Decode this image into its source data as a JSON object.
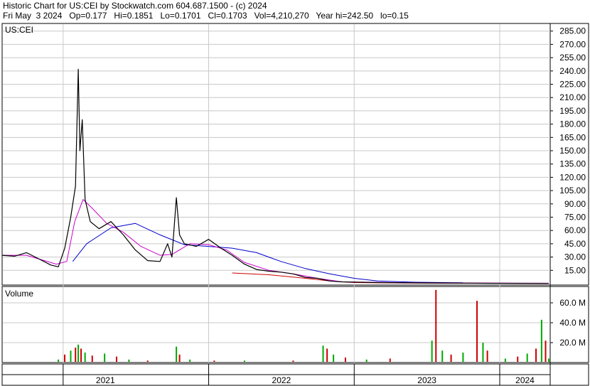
{
  "header": {
    "line1": "Historic Chart for US:CEI by Stockwatch.com 604.687.1500 - (c) 2024",
    "line2": "Fri May  3 2024   Op=0.177   Hi=0.1851   Lo=0.1701   Cl=0.1703   Vol=4,210,270   Year hi=242.50   lo=0.15"
  },
  "chart_data": {
    "type": "line",
    "symbol_label": "US:CEI",
    "volume_label": "Volume",
    "price_axis": {
      "min": 0,
      "max": 292,
      "ticks": [
        "285.00",
        "270.00",
        "255.00",
        "240.00",
        "225.00",
        "210.00",
        "195.00",
        "180.00",
        "165.00",
        "150.00",
        "135.00",
        "120.00",
        "105.00",
        "90.00",
        "75.00",
        "60.00",
        "45.00",
        "30.00",
        "15.00"
      ]
    },
    "volume_axis": {
      "min": 0,
      "max": 75,
      "unit": "M",
      "ticks": [
        "60.0 M",
        "40.0 M",
        "20.0 M"
      ]
    },
    "years": [
      "2021",
      "2022",
      "2023",
      "2024"
    ],
    "x_range": [
      "2020-08-01",
      "2024-05-03"
    ],
    "price_series": [
      {
        "t": "2020-08-01",
        "v": 32
      },
      {
        "t": "2020-09-01",
        "v": 31
      },
      {
        "t": "2020-10-01",
        "v": 35
      },
      {
        "t": "2020-11-01",
        "v": 28
      },
      {
        "t": "2020-12-01",
        "v": 21
      },
      {
        "t": "2020-12-20",
        "v": 19
      },
      {
        "t": "2021-01-05",
        "v": 40
      },
      {
        "t": "2021-01-20",
        "v": 75
      },
      {
        "t": "2021-02-01",
        "v": 110
      },
      {
        "t": "2021-02-08",
        "v": 242
      },
      {
        "t": "2021-02-12",
        "v": 150
      },
      {
        "t": "2021-02-18",
        "v": 185
      },
      {
        "t": "2021-02-25",
        "v": 95
      },
      {
        "t": "2021-03-10",
        "v": 70
      },
      {
        "t": "2021-04-01",
        "v": 62
      },
      {
        "t": "2021-05-01",
        "v": 70
      },
      {
        "t": "2021-06-01",
        "v": 55
      },
      {
        "t": "2021-07-01",
        "v": 38
      },
      {
        "t": "2021-08-01",
        "v": 26
      },
      {
        "t": "2021-09-01",
        "v": 25
      },
      {
        "t": "2021-09-20",
        "v": 45
      },
      {
        "t": "2021-10-01",
        "v": 30
      },
      {
        "t": "2021-10-12",
        "v": 97
      },
      {
        "t": "2021-10-20",
        "v": 55
      },
      {
        "t": "2021-11-01",
        "v": 45
      },
      {
        "t": "2021-12-01",
        "v": 42
      },
      {
        "t": "2022-01-01",
        "v": 50
      },
      {
        "t": "2022-02-01",
        "v": 40
      },
      {
        "t": "2022-03-01",
        "v": 32
      },
      {
        "t": "2022-04-01",
        "v": 22
      },
      {
        "t": "2022-05-01",
        "v": 16
      },
      {
        "t": "2022-06-01",
        "v": 14
      },
      {
        "t": "2022-07-01",
        "v": 13
      },
      {
        "t": "2022-08-01",
        "v": 11
      },
      {
        "t": "2022-09-01",
        "v": 7
      },
      {
        "t": "2022-10-01",
        "v": 6
      },
      {
        "t": "2022-11-01",
        "v": 3
      },
      {
        "t": "2022-12-01",
        "v": 2
      },
      {
        "t": "2023-03-01",
        "v": 1.2
      },
      {
        "t": "2023-07-01",
        "v": 0.8
      },
      {
        "t": "2023-12-01",
        "v": 0.4
      },
      {
        "t": "2024-05-03",
        "v": 0.17
      }
    ],
    "ma_short": [
      {
        "t": "2020-08-01",
        "v": 32
      },
      {
        "t": "2020-10-01",
        "v": 32
      },
      {
        "t": "2020-12-15",
        "v": 22
      },
      {
        "t": "2021-01-10",
        "v": 25
      },
      {
        "t": "2021-01-30",
        "v": 70
      },
      {
        "t": "2021-02-20",
        "v": 95
      },
      {
        "t": "2021-03-15",
        "v": 85
      },
      {
        "t": "2021-04-20",
        "v": 68
      },
      {
        "t": "2021-06-01",
        "v": 58
      },
      {
        "t": "2021-07-15",
        "v": 42
      },
      {
        "t": "2021-09-01",
        "v": 32
      },
      {
        "t": "2021-10-01",
        "v": 33
      },
      {
        "t": "2021-11-15",
        "v": 45
      },
      {
        "t": "2022-01-01",
        "v": 44
      },
      {
        "t": "2022-02-15",
        "v": 38
      },
      {
        "t": "2022-04-01",
        "v": 24
      },
      {
        "t": "2022-06-01",
        "v": 15
      },
      {
        "t": "2022-08-01",
        "v": 11
      },
      {
        "t": "2022-10-01",
        "v": 6
      },
      {
        "t": "2022-12-01",
        "v": 2
      },
      {
        "t": "2023-06-01",
        "v": 1
      },
      {
        "t": "2024-05-03",
        "v": 0.5
      }
    ],
    "ma_long": [
      {
        "t": "2021-01-25",
        "v": 25
      },
      {
        "t": "2021-03-01",
        "v": 45
      },
      {
        "t": "2021-05-01",
        "v": 63
      },
      {
        "t": "2021-07-01",
        "v": 68
      },
      {
        "t": "2021-09-01",
        "v": 55
      },
      {
        "t": "2021-11-01",
        "v": 44
      },
      {
        "t": "2022-01-01",
        "v": 42
      },
      {
        "t": "2022-03-01",
        "v": 40
      },
      {
        "t": "2022-05-01",
        "v": 35
      },
      {
        "t": "2022-07-01",
        "v": 25
      },
      {
        "t": "2022-09-01",
        "v": 17
      },
      {
        "t": "2022-11-01",
        "v": 11
      },
      {
        "t": "2023-01-01",
        "v": 6
      },
      {
        "t": "2023-03-01",
        "v": 3
      },
      {
        "t": "2023-06-01",
        "v": 1.6
      },
      {
        "t": "2023-10-01",
        "v": 1
      }
    ],
    "ma_ultra": [
      {
        "t": "2022-03-01",
        "v": 12
      },
      {
        "t": "2022-06-01",
        "v": 10
      },
      {
        "t": "2022-09-01",
        "v": 6
      },
      {
        "t": "2022-11-01",
        "v": 3
      },
      {
        "t": "2023-01-01",
        "v": 1.2
      },
      {
        "t": "2023-06-01",
        "v": 0.6
      },
      {
        "t": "2024-05-03",
        "v": 0.3
      }
    ],
    "volume_series": [
      {
        "t": "2020-12-20",
        "v": 3
      },
      {
        "t": "2021-01-05",
        "v": 8
      },
      {
        "t": "2021-01-20",
        "v": 12
      },
      {
        "t": "2021-02-01",
        "v": 15
      },
      {
        "t": "2021-02-08",
        "v": 18
      },
      {
        "t": "2021-02-15",
        "v": 14
      },
      {
        "t": "2021-02-25",
        "v": 10
      },
      {
        "t": "2021-03-15",
        "v": 7
      },
      {
        "t": "2021-04-15",
        "v": 9
      },
      {
        "t": "2021-05-15",
        "v": 6
      },
      {
        "t": "2021-06-15",
        "v": 3
      },
      {
        "t": "2021-08-01",
        "v": 2
      },
      {
        "t": "2021-10-12",
        "v": 16
      },
      {
        "t": "2021-10-20",
        "v": 8
      },
      {
        "t": "2021-11-15",
        "v": 3
      },
      {
        "t": "2022-01-15",
        "v": 2
      },
      {
        "t": "2022-04-01",
        "v": 2
      },
      {
        "t": "2022-08-01",
        "v": 2
      },
      {
        "t": "2022-10-15",
        "v": 17
      },
      {
        "t": "2022-10-25",
        "v": 14
      },
      {
        "t": "2022-11-10",
        "v": 8
      },
      {
        "t": "2022-12-10",
        "v": 5
      },
      {
        "t": "2023-02-01",
        "v": 3
      },
      {
        "t": "2023-04-01",
        "v": 4
      },
      {
        "t": "2023-07-15",
        "v": 22
      },
      {
        "t": "2023-07-25",
        "v": 73
      },
      {
        "t": "2023-08-10",
        "v": 12
      },
      {
        "t": "2023-09-01",
        "v": 8
      },
      {
        "t": "2023-10-01",
        "v": 10
      },
      {
        "t": "2023-11-05",
        "v": 62
      },
      {
        "t": "2023-11-20",
        "v": 20
      },
      {
        "t": "2023-12-01",
        "v": 12
      },
      {
        "t": "2024-01-15",
        "v": 4
      },
      {
        "t": "2024-02-15",
        "v": 6
      },
      {
        "t": "2024-03-10",
        "v": 9
      },
      {
        "t": "2024-04-01",
        "v": 14
      },
      {
        "t": "2024-04-15",
        "v": 43
      },
      {
        "t": "2024-04-25",
        "v": 22
      },
      {
        "t": "2024-05-03",
        "v": 4
      }
    ],
    "colors": {
      "price": "#000000",
      "ma_short": "#cc00cc",
      "ma_long": "#0000cc",
      "ma_ultra": "#cc0000",
      "volume_up": "#00aa00",
      "volume_down": "#cc0000",
      "grid": "#c8c8c8"
    },
    "grid": true,
    "legend": "none"
  }
}
